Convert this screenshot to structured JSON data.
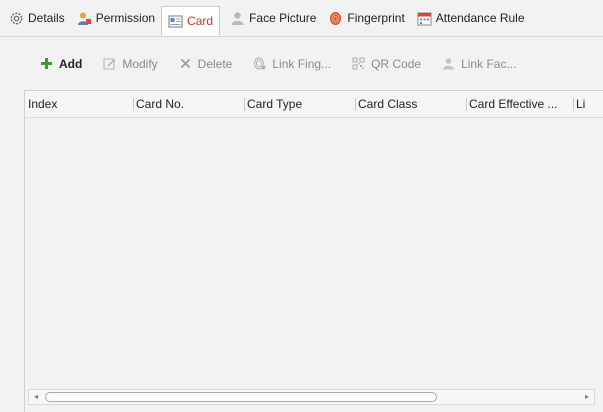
{
  "tabs": [
    {
      "label": "Details",
      "icon": "gear-icon"
    },
    {
      "label": "Permission",
      "icon": "user-permission-icon"
    },
    {
      "label": "Card",
      "icon": "card-icon",
      "active": true
    },
    {
      "label": "Face Picture",
      "icon": "person-icon"
    },
    {
      "label": "Fingerprint",
      "icon": "fingerprint-icon"
    },
    {
      "label": "Attendance Rule",
      "icon": "calendar-icon"
    }
  ],
  "toolbar": {
    "add": "Add",
    "modify": "Modify",
    "delete": "Delete",
    "link_fingerprint": "Link Fing...",
    "qr_code": "QR Code",
    "link_face": "Link Fac..."
  },
  "table": {
    "columns": [
      "Index",
      "Card No.",
      "Card Type",
      "Card Class",
      "Card Effective ...",
      "Li"
    ],
    "rows": []
  },
  "colors": {
    "active_tab_text": "#d0322e",
    "add_icon": "#3a9c2a"
  }
}
